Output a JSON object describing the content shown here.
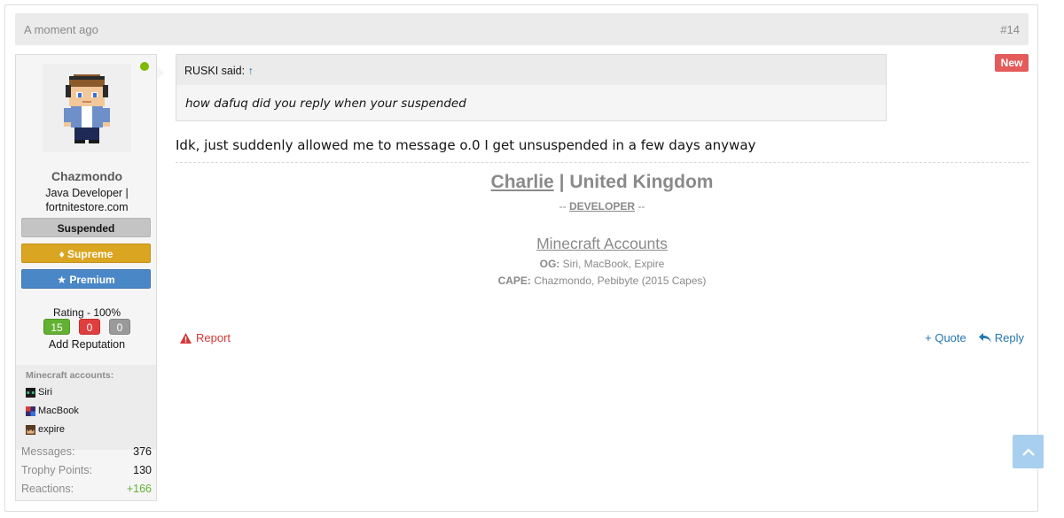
{
  "post": {
    "date": "A moment ago",
    "number": "#14",
    "new_badge": "New"
  },
  "user": {
    "username": "Chazmondo",
    "title": "Java Developer | fortnitestore.com",
    "banners": [
      "Suspended",
      "Supreme",
      "Premium"
    ],
    "rating_label": "Rating - 100%",
    "rep_positive": "15",
    "rep_negative": "0",
    "rep_neutral": "0",
    "add_reputation": "Add Reputation",
    "mc_title": "Minecraft accounts:",
    "mc_accounts": [
      "Siri",
      "MacBook",
      "expire"
    ],
    "stats": [
      {
        "label": "Messages:",
        "value": "376"
      },
      {
        "label": "Trophy Points:",
        "value": "130"
      },
      {
        "label": "Reactions:",
        "value": "+166"
      }
    ]
  },
  "quote": {
    "author": "RUSKI said:",
    "arrow": "↑",
    "text": "how dafuq did you reply when your suspended"
  },
  "message": "Idk, just suddenly allowed me to message o.0 I get unsuspended in a few days anyway",
  "signature": {
    "name": "Charlie",
    "separator": "|",
    "country": "United Kingdom",
    "dev_prefix": "--",
    "dev_role": "DEVELOPER",
    "dev_suffix": "--",
    "mc_heading": "Minecraft Accounts",
    "og_label": "OG:",
    "og_value": "Siri, MacBook, Expire",
    "cape_label": "CAPE:",
    "cape_value": "Chazmondo, Pebibyte (2015 Capes)"
  },
  "actions": {
    "report": "Report",
    "quote": "+ Quote",
    "reply": "Reply"
  },
  "colors": {
    "accent": "#2577b1",
    "report": "#d53636",
    "online": "#7fb900",
    "positive": "#63b132"
  },
  "icons": {
    "report": "warning-triangle-icon",
    "reply": "reply-arrow-icon",
    "scroll_top": "chevron-up-icon",
    "supreme": "diamond-icon",
    "premium": "trophy-icon"
  }
}
